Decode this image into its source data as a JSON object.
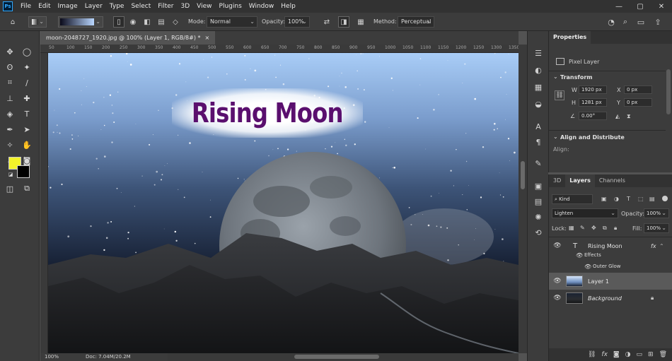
{
  "menubar": {
    "logo": "Ps",
    "items": [
      "File",
      "Edit",
      "Image",
      "Layer",
      "Type",
      "Select",
      "Filter",
      "3D",
      "View",
      "Plugins",
      "Window",
      "Help"
    ],
    "controls": [
      "—",
      "▢",
      "✕"
    ]
  },
  "options": {
    "mode_label": "Mode:",
    "mode_value": "Normal",
    "opacity_label": "Opacity:",
    "opacity_value": "100%",
    "method_label": "Method:",
    "method_value": "Perceptual"
  },
  "document": {
    "tab_title": "moon-2048727_1920.jpg @ 100% (Layer 1, RGB/8#) *",
    "close": "×",
    "ruler_ticks": [
      "50",
      "100",
      "150",
      "200",
      "250",
      "300",
      "350",
      "400",
      "450",
      "500",
      "550",
      "600",
      "650",
      "700",
      "750",
      "800",
      "850",
      "900",
      "950",
      "1000",
      "1050",
      "1100",
      "1150",
      "1200",
      "1250",
      "1300",
      "1350"
    ],
    "headline": "Rising Moon",
    "zoom": "100%",
    "doc_info": "Doc: 7.04M/20.2M"
  },
  "properties": {
    "tab": "Properties",
    "kind": "Pixel Layer",
    "transform_title": "Transform",
    "w_label": "W",
    "w_value": "1920 px",
    "h_label": "H",
    "h_value": "1281 px",
    "x_label": "X",
    "x_value": "0 px",
    "y_label": "Y",
    "y_value": "0 px",
    "angle_value": "0.00°",
    "align_title": "Align and Distribute",
    "align_label": "Align:"
  },
  "layers": {
    "tabs": [
      "3D",
      "Layers",
      "Channels"
    ],
    "kind_value": "Kind",
    "blend_value": "Lighten",
    "opacity_label": "Opacity:",
    "opacity_value": "100%",
    "lock_label": "Lock:",
    "fill_label": "Fill:",
    "fill_value": "100%",
    "items": [
      {
        "name": "Rising Moon",
        "type": "text"
      },
      {
        "name": "Effects",
        "type": "effects"
      },
      {
        "name": "Outer Glow",
        "type": "effect"
      },
      {
        "name": "Layer 1",
        "type": "pixel"
      },
      {
        "name": "Background",
        "type": "background"
      }
    ],
    "fx_badge": "fx"
  },
  "colors": {
    "foreground": "#f2f22a",
    "background": "#000000",
    "headline": "#5a0f6e"
  }
}
